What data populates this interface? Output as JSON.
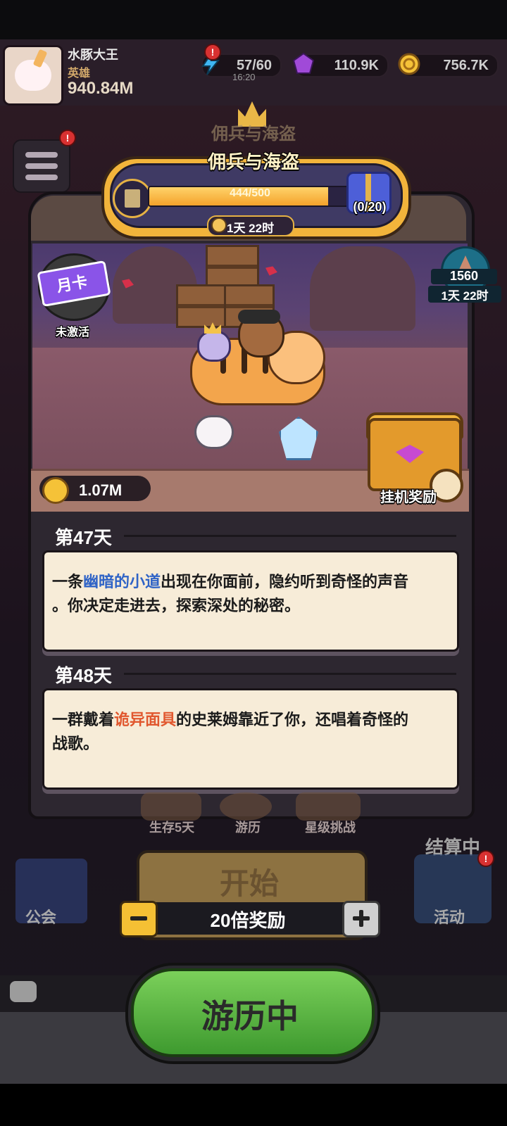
{
  "player": {
    "name": "水豚大王",
    "rank": "英雄",
    "power": "940.84M"
  },
  "resources": {
    "energy": "57/60",
    "energy_timer": "16:20",
    "gems": "110.9K",
    "coins": "756.7K"
  },
  "event": {
    "title": "佣兵与海盗",
    "progress_text": "444/500",
    "progress_value": 0.888,
    "reward_count": "(0/20)",
    "time_left": "1天 22时"
  },
  "scene": {
    "month_card_label": "月卡",
    "month_card_status": "未激活",
    "rank_value": "1560",
    "rank_time": "1天 22时",
    "idle_coins": "1.07M",
    "idle_reward_label": "挂机奖励"
  },
  "log": [
    {
      "day": "第47天",
      "parts": [
        "一条",
        "幽暗的小道",
        "出现在你面前，隐约听到奇怪的声音",
        "。你决定走进去，探索深处的秘密。"
      ]
    },
    {
      "day": "第48天",
      "parts": [
        "一群戴着",
        "诡异面具",
        "的史莱姆靠近了你，还唱着奇怪的",
        "战歌。"
      ]
    }
  ],
  "bottom": {
    "tab_survive": "生存5天",
    "tab_travel": "游历",
    "tab_star": "星级挑战",
    "settling": "结算中",
    "guild": "公会",
    "activity": "活动",
    "start": "开始",
    "multiplier": "20倍奖励",
    "traveling": "游历中"
  },
  "colors": {
    "highlight_blue": "#2f63c6",
    "highlight_orange": "#e1582f",
    "gold": "#f2b43b",
    "green_button": "#4fb43a"
  }
}
